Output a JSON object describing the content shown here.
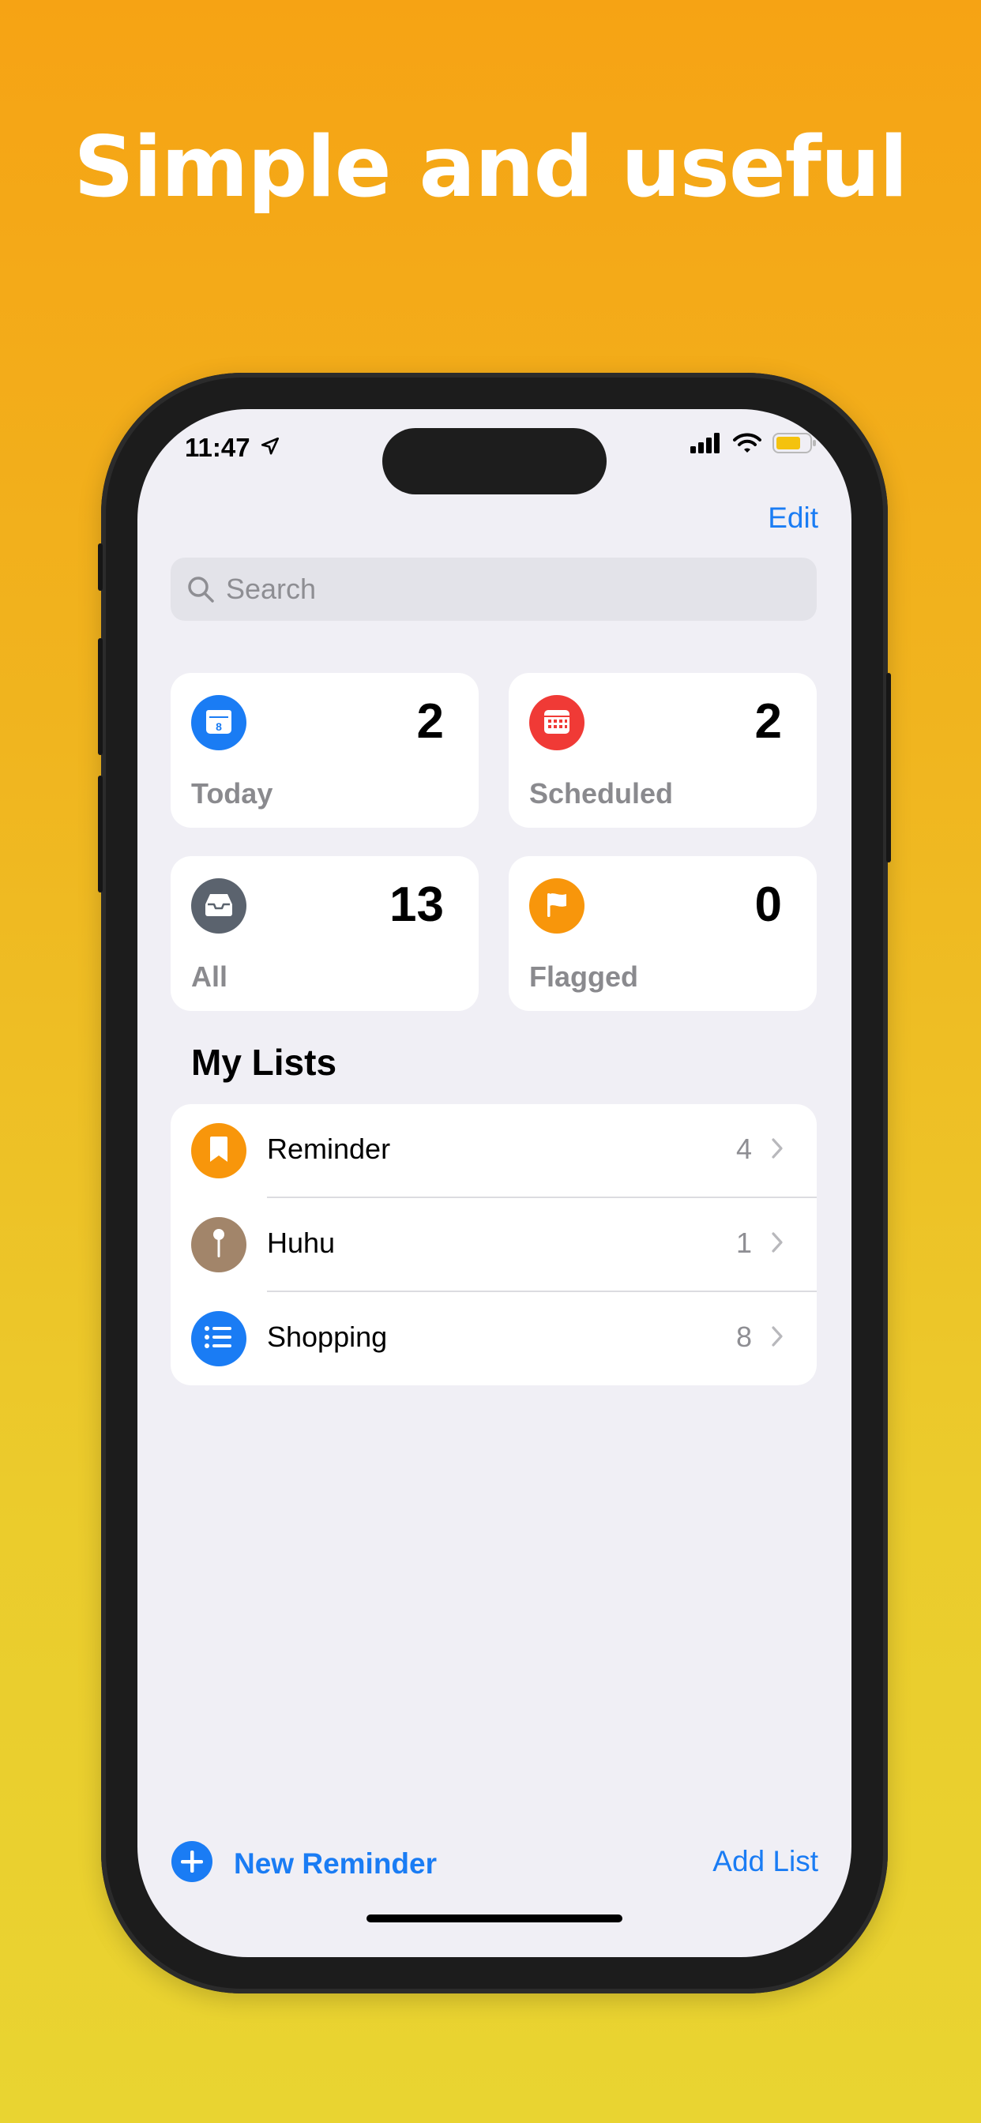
{
  "headline": "Simple and useful",
  "status_bar": {
    "time": "11:47"
  },
  "nav": {
    "edit_label": "Edit"
  },
  "search": {
    "placeholder": "Search"
  },
  "smart_lists": [
    {
      "label": "Today",
      "count": "2",
      "color": "#1A7CF4",
      "icon": "calendar-icon"
    },
    {
      "label": "Scheduled",
      "count": "2",
      "color": "#F03A36",
      "icon": "calendar-grid-icon"
    },
    {
      "label": "All",
      "count": "13",
      "color": "#5B636E",
      "icon": "tray-icon"
    },
    {
      "label": "Flagged",
      "count": "0",
      "color": "#F8960B",
      "icon": "flag-icon"
    }
  ],
  "today_icon_day": "8",
  "my_lists": {
    "title": "My Lists",
    "items": [
      {
        "name": "Reminder",
        "count": "4",
        "color": "#F8960B",
        "icon": "bookmark-icon"
      },
      {
        "name": "Huhu",
        "count": "1",
        "color": "#A2856A",
        "icon": "pin-icon"
      },
      {
        "name": "Shopping",
        "count": "8",
        "color": "#1A7CF4",
        "icon": "list-bullet-icon"
      }
    ]
  },
  "toolbar": {
    "new_reminder_label": "New Reminder",
    "add_list_label": "Add List"
  }
}
